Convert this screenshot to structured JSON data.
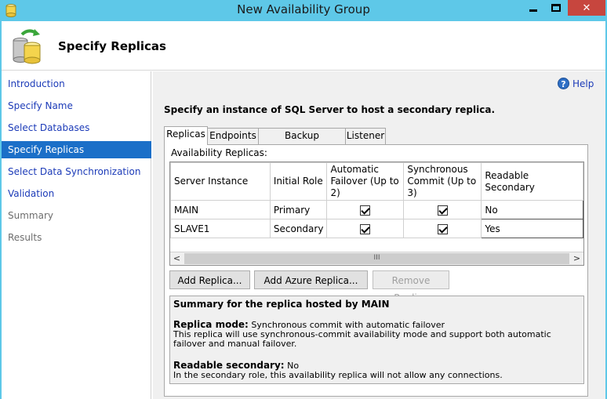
{
  "window": {
    "title": "New Availability Group",
    "controls": {
      "minimize": "minimize-icon",
      "maximize": "maximize-icon",
      "close": "close-icon"
    }
  },
  "header": {
    "title": "Specify Replicas",
    "icon": "database-sync-icon"
  },
  "sidebar": {
    "items": [
      {
        "label": "Introduction",
        "state": "link"
      },
      {
        "label": "Specify Name",
        "state": "link"
      },
      {
        "label": "Select Databases",
        "state": "link"
      },
      {
        "label": "Specify Replicas",
        "state": "active"
      },
      {
        "label": "Select Data Synchronization",
        "state": "link"
      },
      {
        "label": "Validation",
        "state": "link"
      },
      {
        "label": "Summary",
        "state": "disabled"
      },
      {
        "label": "Results",
        "state": "disabled"
      }
    ]
  },
  "main": {
    "help_label": "Help",
    "instruction": "Specify an instance of SQL Server to host a secondary replica.",
    "tabs": [
      {
        "label": "Replicas",
        "active": true
      },
      {
        "label": "Endpoints",
        "active": false
      },
      {
        "label": "Backup Preferences",
        "active": false
      },
      {
        "label": "Listener",
        "active": false
      }
    ],
    "availability_label": "Availability Replicas:",
    "table": {
      "columns": [
        "Server Instance",
        "Initial Role",
        "Automatic Failover (Up to 2)",
        "Synchronous Commit (Up to 3)",
        "Readable Secondary"
      ],
      "rows": [
        {
          "server": "MAIN",
          "role": "Primary",
          "auto_failover": true,
          "sync_commit": true,
          "readable": "No"
        },
        {
          "server": "SLAVE1",
          "role": "Secondary",
          "auto_failover": true,
          "sync_commit": true,
          "readable": "Yes"
        }
      ]
    },
    "scrollbar": {
      "left_arrow": "<",
      "right_arrow": ">",
      "thumb_grip": "III"
    },
    "buttons": {
      "add_replica": "Add Replica...",
      "add_azure_replica": "Add Azure Replica...",
      "remove_replica": "Remove Replica"
    },
    "summary": {
      "title": "Summary for the replica hosted by MAIN",
      "replica_mode_label": "Replica mode:",
      "replica_mode_value": "Synchronous commit with automatic failover",
      "replica_mode_desc": "This replica will use synchronous-commit availability mode and support both automatic failover and manual failover.",
      "readable_label": "Readable secondary:",
      "readable_value": "No",
      "readable_desc": "In the secondary role, this availability replica will not allow any connections."
    }
  },
  "colors": {
    "titlebar": "#5ec8e8",
    "close_button": "#c7463e",
    "nav_active": "#1b6fc8",
    "link": "#1c3bb8"
  }
}
